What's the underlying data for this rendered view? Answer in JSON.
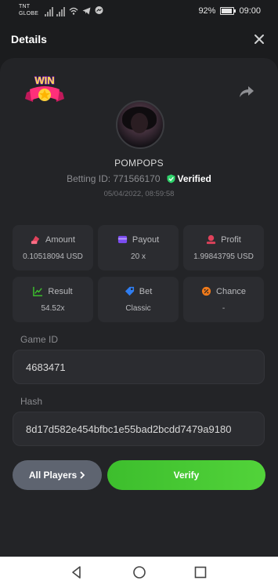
{
  "status_bar": {
    "carrier_line1": "TNT",
    "carrier_line2": "GLOBE",
    "battery": "92%",
    "battery_level": 0.92,
    "time": "09:00"
  },
  "header": {
    "title": "Details"
  },
  "profile": {
    "logo_text": "WIN",
    "username": "POMPOPS",
    "betting_id_label": "Betting ID: 771566170",
    "verified_label": "Verified",
    "datetime": "05/04/2022, 08:59:58"
  },
  "stats": [
    {
      "label": "Amount",
      "value": "0.10518094 USD",
      "icon": "money-icon",
      "color": "#e0425b"
    },
    {
      "label": "Payout",
      "value": "20 x",
      "icon": "wallet-icon",
      "color": "#7b4cf0"
    },
    {
      "label": "Profit",
      "value": "1.99843795 USD",
      "icon": "profit-icon",
      "color": "#e0425b"
    },
    {
      "label": "Result",
      "value": "54.52x",
      "icon": "chart-icon",
      "color": "#3dbe2d"
    },
    {
      "label": "Bet",
      "value": "Classic",
      "icon": "tag-icon",
      "color": "#2f7df0"
    },
    {
      "label": "Chance",
      "value": "-",
      "icon": "percent-icon",
      "color": "#f07a1a"
    }
  ],
  "fields": {
    "game_id_label": "Game ID",
    "game_id_value": "4683471",
    "hash_label": "Hash",
    "hash_value": "8d17d582e454bfbc1e55bad2bcdd7479a9180"
  },
  "buttons": {
    "all_players": "All Players",
    "verify": "Verify"
  },
  "colors": {
    "accent_green": "#3dbe2d",
    "verified_green": "#2fd36b",
    "background": "#1b1c1e",
    "card": "#232427"
  }
}
